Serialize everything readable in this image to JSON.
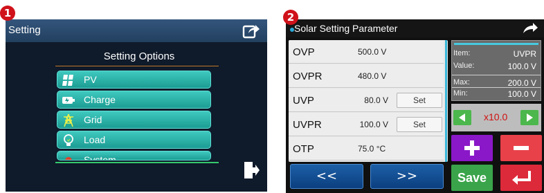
{
  "badges": {
    "first": "1",
    "second": "2"
  },
  "screen1": {
    "title": "Setting",
    "options_title": "Setting Options",
    "buttons": [
      {
        "label": "PV",
        "icon": "solar-panel-icon"
      },
      {
        "label": "Charge",
        "icon": "battery-charge-icon"
      },
      {
        "label": "Grid",
        "icon": "power-tower-icon"
      },
      {
        "label": "Load",
        "icon": "light-bulb-icon"
      },
      {
        "label": "System",
        "icon": "system-icon"
      }
    ],
    "icons": {
      "share": "share-icon",
      "exit": "exit-door-icon"
    },
    "colors": {
      "header": "#2b4a6f",
      "background": "#0f1a2a",
      "button": "#2ab2a8",
      "divider": "#c47a2a",
      "bottom_line": "#36c96d"
    }
  },
  "screen2": {
    "title": "Solar Setting Parameter",
    "rows": [
      {
        "name": "OVP",
        "value": "500.0 V",
        "set": ""
      },
      {
        "name": "OVPR",
        "value": "480.0 V",
        "set": ""
      },
      {
        "name": "UVP",
        "value": "80.0 V",
        "set": "Set"
      },
      {
        "name": "UVPR",
        "value": "100.0 V",
        "set": "Set"
      },
      {
        "name": "OTP",
        "value": "75.0 °C",
        "set": ""
      }
    ],
    "nav": {
      "prev": "<<",
      "next": ">>"
    },
    "info": {
      "item_label": "Item:",
      "item_value": "UVPR",
      "value_label": "Value:",
      "value_value": "100.0 V",
      "max_label": "Max:",
      "max_value": "200.0 V",
      "min_label": "Min:",
      "min_value": "100.0 V"
    },
    "step_label": "x10.0",
    "save_label": "Save",
    "colors": {
      "plus": "#8a18c8",
      "minus": "#e8414a",
      "save": "#3aa44a",
      "enter": "#dd2a3a",
      "nav": "#1552a0",
      "arrows": "#4cb74c"
    }
  }
}
